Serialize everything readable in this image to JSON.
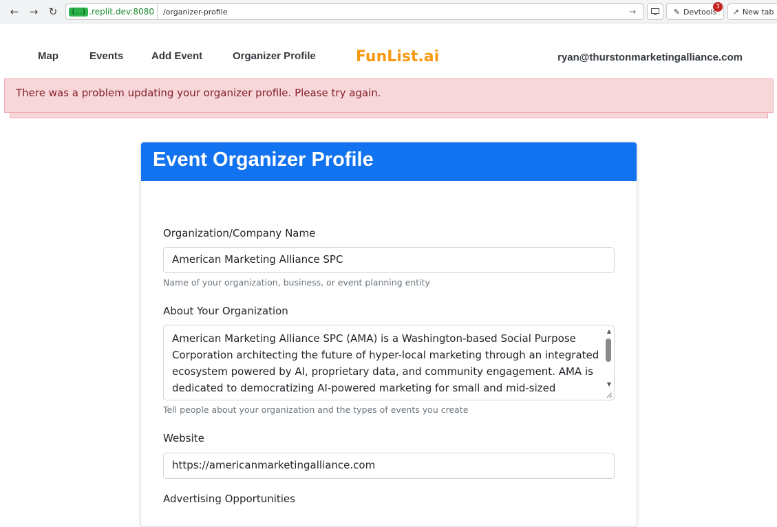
{
  "browser": {
    "host_pill": "{...}",
    "host": ".replit.dev:8080",
    "path": "/organizer-profile",
    "devtools_label": "Devtools",
    "devtools_badge": "3",
    "newtab_label": "New tab"
  },
  "nav": {
    "links": [
      "Map",
      "Events",
      "Add Event",
      "Organizer Profile"
    ],
    "brand": "FunList.ai",
    "user_email": "ryan@thurstonmarketingalliance.com"
  },
  "alert": {
    "message": "There was a problem updating your organizer profile. Please try again."
  },
  "card": {
    "title": "Event Organizer Profile",
    "org_name": {
      "label": "Organization/Company Name",
      "value": "American Marketing Alliance SPC",
      "help": "Name of your organization, business, or event planning entity"
    },
    "about": {
      "label": "About Your Organization",
      "value": "American Marketing Alliance SPC (AMA) is a Washington-based Social Purpose Corporation architecting the future of hyper-local marketing through an integrated ecosystem powered by AI, proprietary data, and community engagement. AMA is dedicated to democratizing AI-powered marketing for small and mid-sized businesses",
      "help": "Tell people about your organization and the types of events you create"
    },
    "website": {
      "label": "Website",
      "value": "https://americanmarketingalliance.com"
    },
    "advertising": {
      "label": "Advertising Opportunities"
    }
  },
  "colors": {
    "brand": "#f79a12",
    "header": "#1273f0",
    "alert_bg": "#f8d7da",
    "alert_text": "#842029"
  }
}
